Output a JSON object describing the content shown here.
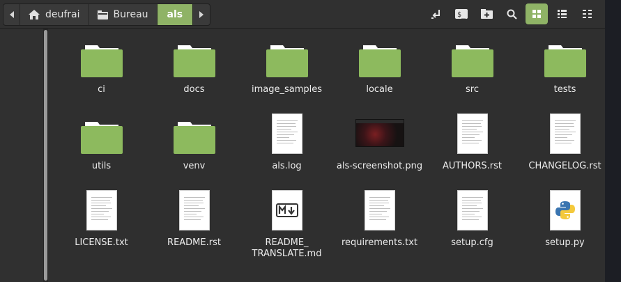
{
  "breadcrumb": {
    "home_label": "deufrai",
    "bureau_label": "Bureau",
    "current_label": "als"
  },
  "colors": {
    "accent": "#8fb366",
    "folder": "#8dba5e",
    "folder_tab": "#ffffff"
  },
  "toolbar_icons": [
    "open-terminal-icon",
    "terminal-icon",
    "new-folder-icon",
    "search-icon",
    "icon-view-icon",
    "list-view-icon",
    "compact-view-icon"
  ],
  "files": [
    {
      "name": "ci",
      "kind": "folder"
    },
    {
      "name": "docs",
      "kind": "folder"
    },
    {
      "name": "image_samples",
      "kind": "folder"
    },
    {
      "name": "locale",
      "kind": "folder"
    },
    {
      "name": "src",
      "kind": "folder"
    },
    {
      "name": "tests",
      "kind": "folder"
    },
    {
      "name": "utils",
      "kind": "folder"
    },
    {
      "name": "venv",
      "kind": "folder"
    },
    {
      "name": "als.log",
      "kind": "text"
    },
    {
      "name": "als-screenshot.png",
      "kind": "image"
    },
    {
      "name": "AUTHORS.rst",
      "kind": "text"
    },
    {
      "name": "CHANGELOG.rst",
      "kind": "text"
    },
    {
      "name": "LICENSE.txt",
      "kind": "text"
    },
    {
      "name": "README.rst",
      "kind": "text"
    },
    {
      "name": "README_ TRANSLATE.md",
      "kind": "markdown"
    },
    {
      "name": "requirements.txt",
      "kind": "text"
    },
    {
      "name": "setup.cfg",
      "kind": "text"
    },
    {
      "name": "setup.py",
      "kind": "python"
    }
  ]
}
